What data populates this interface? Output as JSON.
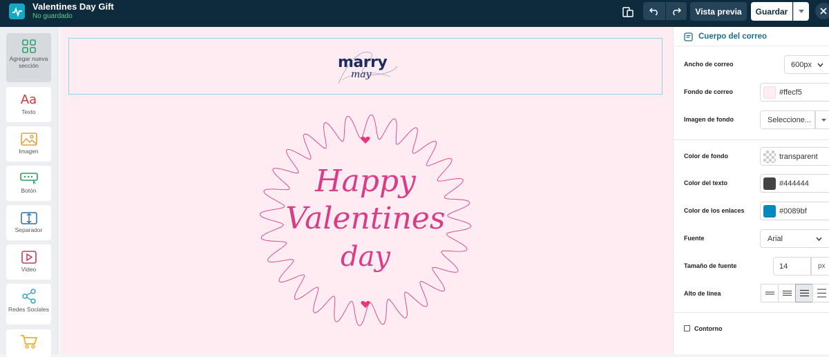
{
  "app": {
    "title": "Valentines Day Gift",
    "status": "No guardado"
  },
  "toolbar": {
    "preview_label": "Vista previa",
    "save_label": "Guardar"
  },
  "tools": [
    {
      "label": "Agregar nueva sección",
      "icon": "add-section-icon"
    },
    {
      "label": "Texto",
      "icon": "text-icon"
    },
    {
      "label": "Imagen",
      "icon": "image-icon"
    },
    {
      "label": "Botón",
      "icon": "button-icon"
    },
    {
      "label": "Separador",
      "icon": "separator-icon"
    },
    {
      "label": "Video",
      "icon": "video-icon"
    },
    {
      "label": "Redes Sociales",
      "icon": "social-icon"
    },
    {
      "label": "",
      "icon": "cart-icon"
    }
  ],
  "canvas": {
    "brand": "marry",
    "brand_sub": "may",
    "hero_lines": [
      "Happy",
      "Valentines",
      "day"
    ]
  },
  "panel": {
    "title": "Cuerpo del correo",
    "email_width": {
      "label": "Ancho de correo",
      "value": "600px"
    },
    "email_bg": {
      "label": "Fondo de correo",
      "value": "#ffecf5"
    },
    "bg_image": {
      "label": "Imagen de fondo",
      "value": "Seleccione..."
    },
    "bg_color": {
      "label": "Color de fondo",
      "value": "transparent"
    },
    "text_color": {
      "label": "Color del texto",
      "value": "#444444"
    },
    "link_color": {
      "label": "Color de los enlaces",
      "value": "#0089bf"
    },
    "font": {
      "label": "Fuente",
      "value": "Arial"
    },
    "font_size": {
      "label": "Tamaño de fuente",
      "value": "14",
      "unit": "px"
    },
    "line_height": {
      "label": "Alto de línea"
    },
    "outline": {
      "label": "Contorno"
    }
  },
  "colors": {
    "topbar": "#0e2b3e",
    "accent": "#15a7c4",
    "canvas_bg": "#ffecf3",
    "pink": "#d83d86"
  }
}
